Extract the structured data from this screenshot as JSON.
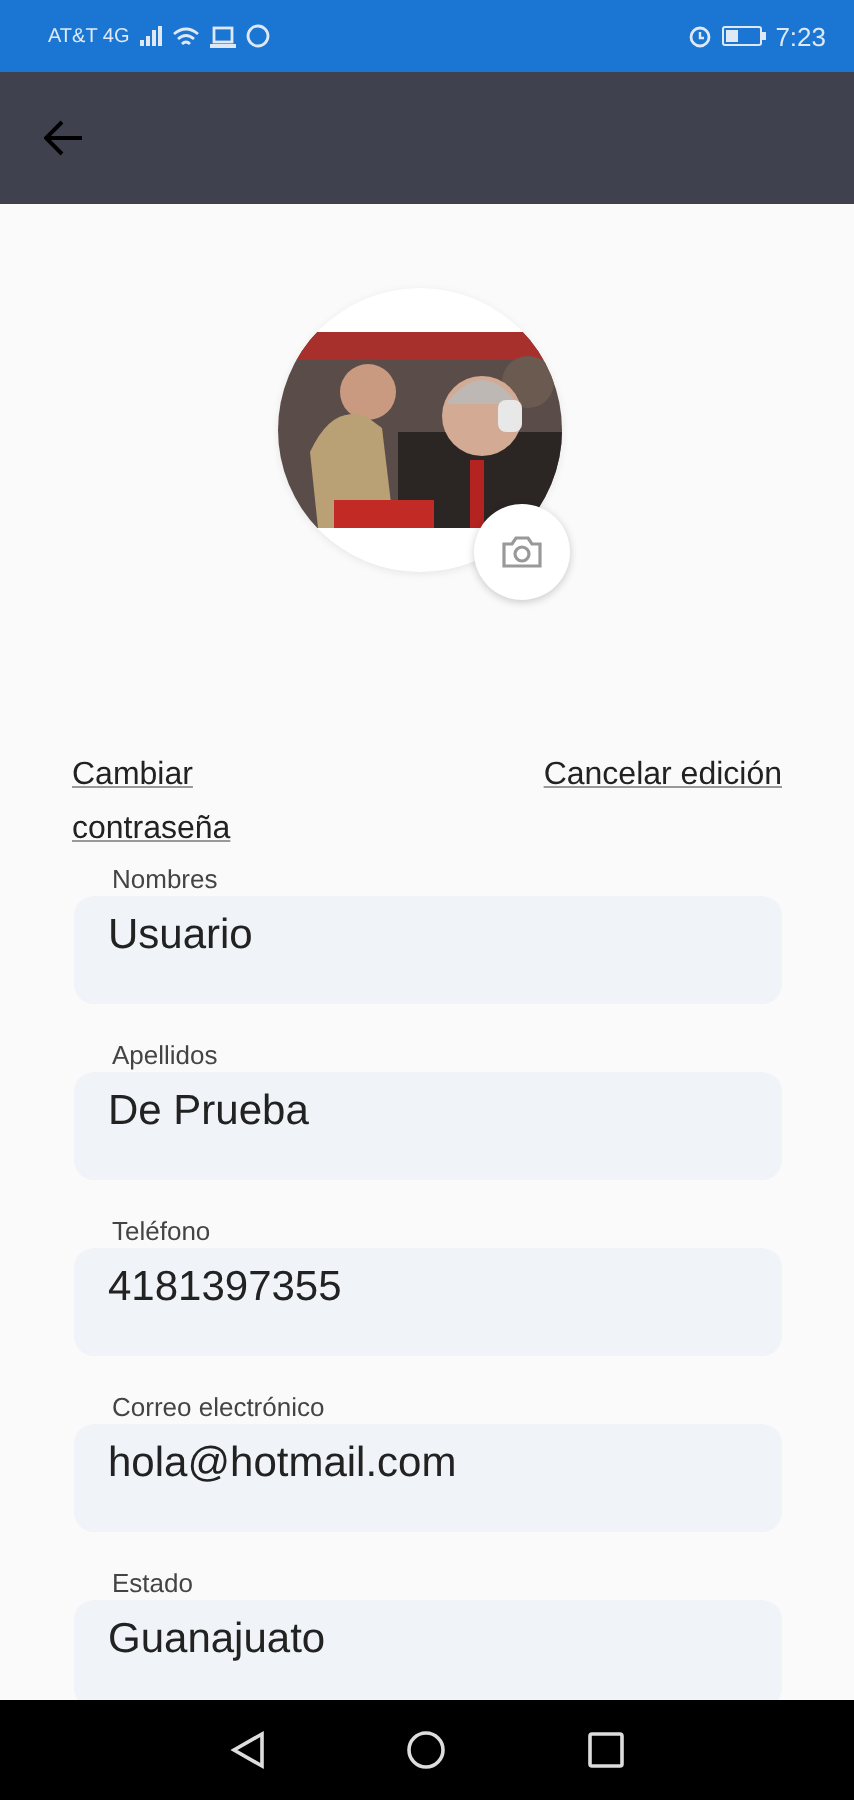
{
  "status_bar": {
    "carrier": "AT&T 4G",
    "time": "7:23"
  },
  "links": [
    {
      "label": "Cambiar contraseña"
    },
    {
      "label": "Cancelar edición"
    }
  ],
  "fields": [
    {
      "label": "Nombres",
      "value": "Usuario"
    },
    {
      "label": "Apellidos",
      "value": "De Prueba"
    },
    {
      "label": "Teléfono",
      "value": "4181397355"
    },
    {
      "label": "Correo electrónico",
      "value": "hola@hotmail.com"
    },
    {
      "label": "Estado",
      "value": "Guanajuato"
    }
  ]
}
